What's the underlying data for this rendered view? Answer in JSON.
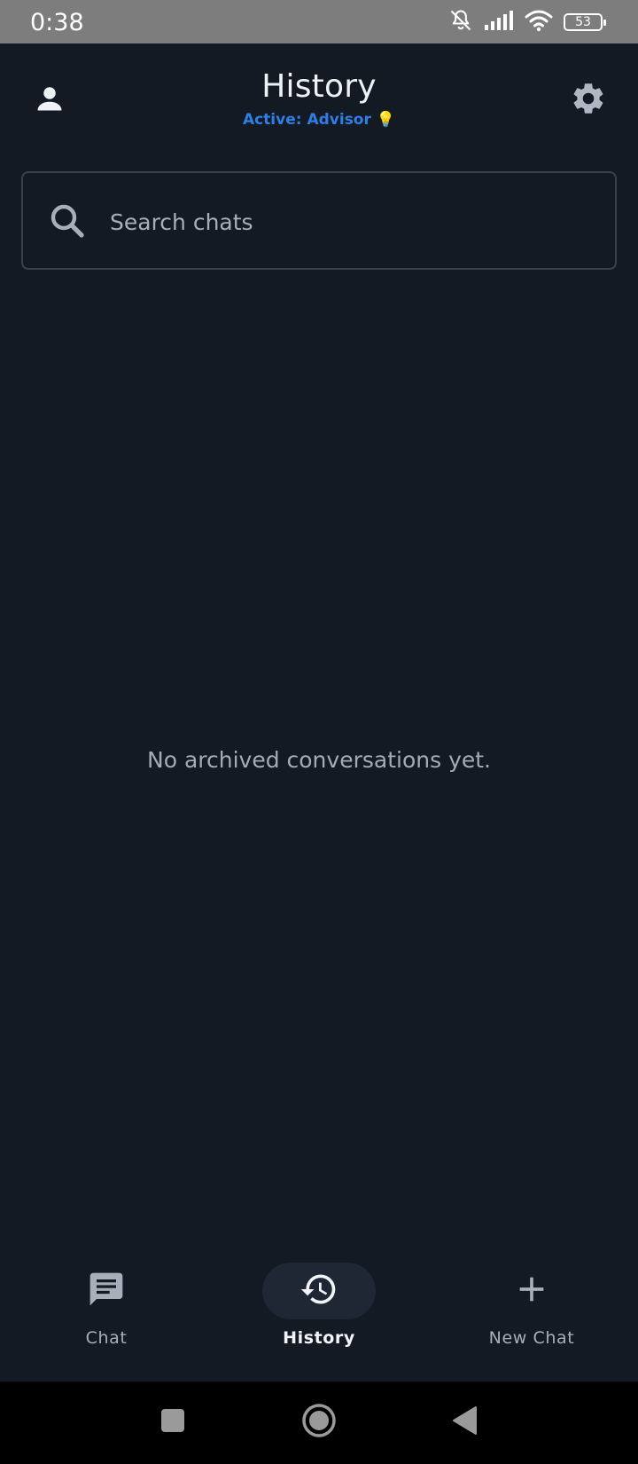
{
  "status_bar": {
    "time": "0:38",
    "battery": "53",
    "icons": [
      "bell-off-icon",
      "signal-icon",
      "wifi-icon",
      "battery-icon"
    ]
  },
  "header": {
    "title": "History",
    "subtitle": "Active: Advisor",
    "subtitle_emoji": "💡",
    "accent_color": "#2f7ee6",
    "left_icon": "person-icon",
    "right_icon": "gear-icon"
  },
  "search": {
    "placeholder": "Search chats",
    "value": ""
  },
  "empty_state": {
    "message": "No archived conversations yet."
  },
  "bottom_nav": {
    "items": [
      {
        "label": "Chat",
        "icon": "chat-icon",
        "active": false
      },
      {
        "label": "History",
        "icon": "history-icon",
        "active": true
      },
      {
        "label": "New Chat",
        "icon": "plus-icon",
        "active": false
      }
    ]
  },
  "system_nav": {
    "buttons": [
      "recents-icon",
      "home-icon",
      "back-icon"
    ]
  },
  "colors": {
    "background": "#131a23",
    "status_bar": "#7d7d7d",
    "active_pill": "#1e2733"
  }
}
